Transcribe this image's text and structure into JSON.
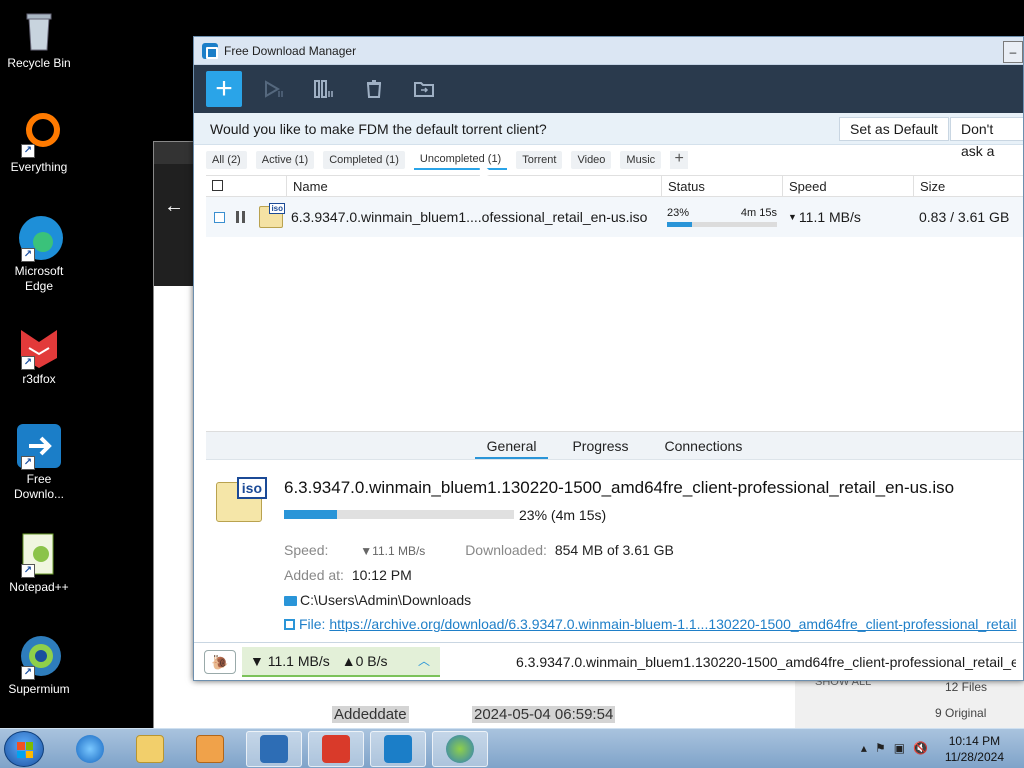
{
  "desktop": {
    "icons": [
      {
        "label": "Recycle Bin"
      },
      {
        "label": "Everything"
      },
      {
        "label": "Microsoft Edge"
      },
      {
        "label": "r3dfox"
      },
      {
        "label": "Free Downlo..."
      },
      {
        "label": "Notepad++"
      },
      {
        "label": "Supermium"
      }
    ]
  },
  "background_window": {
    "addeddate_label": "Addeddate",
    "addeddate_value": "2024-05-04 06:59:54",
    "show_all": "SHOW ALL",
    "files_count": "12 Files",
    "original_count": "9 Original"
  },
  "fdm": {
    "title": "Free Download Manager",
    "notice": {
      "text": "Would you like to make FDM the default torrent client?",
      "set_default": "Set as Default",
      "dont_ask": "Don't ask a"
    },
    "filters": [
      {
        "label": "All (2)"
      },
      {
        "label": "Active (1)"
      },
      {
        "label": "Completed (1)"
      },
      {
        "label": "Uncompleted (1)"
      },
      {
        "label": "Torrent"
      },
      {
        "label": "Video"
      },
      {
        "label": "Music"
      }
    ],
    "add_filter": "+",
    "columns": {
      "name": "Name",
      "status": "Status",
      "speed": "Speed",
      "size": "Size"
    },
    "download": {
      "name": "6.3.9347.0.winmain_bluem1....ofessional_retail_en-us.iso",
      "file_type": "iso",
      "percent": "23%",
      "progress": 0.23,
      "time_left": "4m 15s",
      "speed": "11.1 MB/s",
      "size": "0.83 / 3.61 GB"
    },
    "detail": {
      "tabs": [
        "General",
        "Progress",
        "Connections"
      ],
      "full_name": "6.3.9347.0.winmain_bluem1.130220-1500_amd64fre_client-professional_retail_en-us.iso",
      "progress_text": "23% (4m 15s)",
      "speed_label": "Speed:",
      "speed_value": "11.1 MB/s",
      "downloaded_label": "Downloaded:",
      "downloaded_value": "854 MB of 3.61 GB",
      "added_label": "Added at:",
      "added_value": "10:12 PM",
      "folder": "C:\\Users\\Admin\\Downloads",
      "file_label": "File:",
      "file_url": "https://archive.org/download/6.3.9347.0.winmain-bluem-1.1...130220-1500_amd64fre_client-professional_retail"
    },
    "statusbar": {
      "down_speed": "11.1 MB/s",
      "up_speed": "0 B/s",
      "current_file": "6.3.9347.0.winmain_bluem1.130220-1500_amd64fre_client-professional_retail_e"
    }
  },
  "taskbar": {
    "time": "10:14 PM",
    "date": "11/28/2024"
  }
}
